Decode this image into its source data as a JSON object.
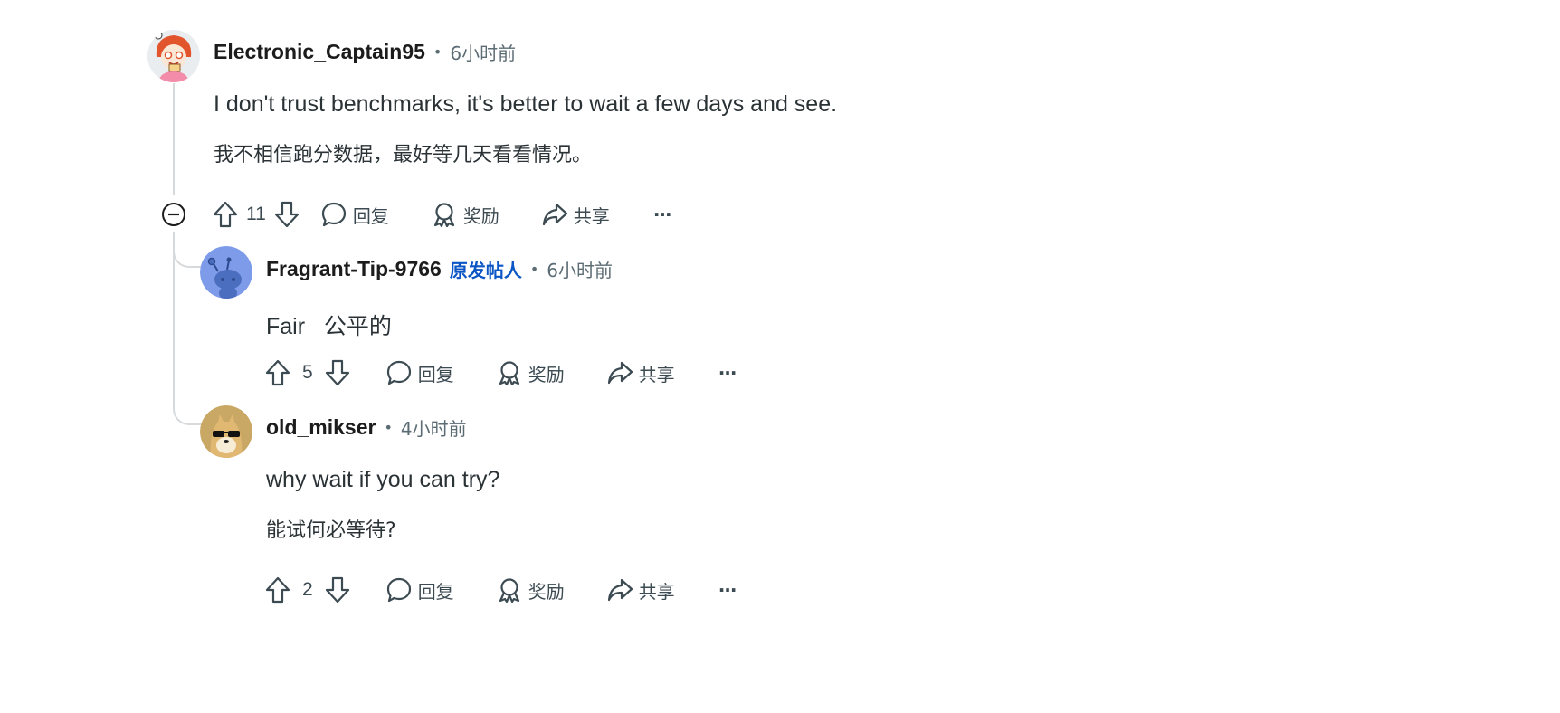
{
  "comments": [
    {
      "username": "Electronic_Captain95",
      "time": "6小时前",
      "text_en": "I don't trust benchmarks, it's better to wait a few days and see.",
      "text_cn": "我不相信跑分数据，最好等几天看看情况。",
      "score": "11",
      "reply_label": "回复",
      "award_label": "奖励",
      "share_label": "共享",
      "more_label": "···"
    },
    {
      "username": "Fragrant-Tip-9766",
      "op_badge": "原发帖人",
      "time": "6小时前",
      "text_en": "Fair   公平的",
      "score": "5",
      "reply_label": "回复",
      "award_label": "奖励",
      "share_label": "共享",
      "more_label": "···"
    },
    {
      "username": "old_mikser",
      "time": "4小时前",
      "text_en": "why wait if you can try?",
      "text_cn": "能试何必等待?",
      "score": "2",
      "reply_label": "回复",
      "award_label": "奖励",
      "share_label": "共享",
      "more_label": "···"
    }
  ],
  "icons": {
    "upvote": "arrow-up-icon",
    "downvote": "arrow-down-icon",
    "reply": "speech-bubble-icon",
    "award": "award-ribbon-icon",
    "share": "share-arrow-icon",
    "collapse": "minus-circle-icon"
  },
  "colors": {
    "op_badge": "#0a56c4",
    "meta_text": "#5c6c74",
    "thread_line": "#d7dadc"
  }
}
